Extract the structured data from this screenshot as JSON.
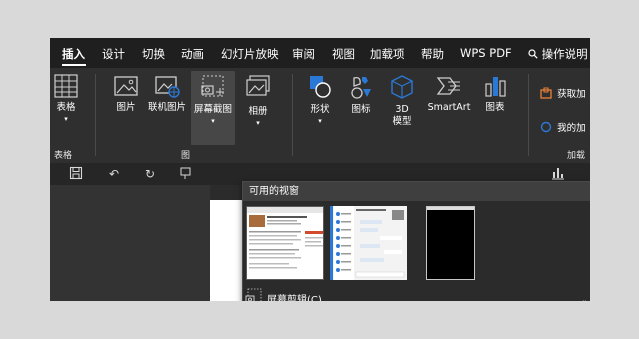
{
  "tabs": [
    {
      "label": "插入",
      "active": true
    },
    {
      "label": "设计"
    },
    {
      "label": "切换"
    },
    {
      "label": "动画"
    },
    {
      "label": "幻灯片放映"
    },
    {
      "label": "审阅"
    },
    {
      "label": "视图"
    },
    {
      "label": "加载项"
    },
    {
      "label": "帮助"
    },
    {
      "label": "WPS PDF"
    },
    {
      "label": "操作说明"
    }
  ],
  "ribbon": {
    "table": {
      "label": "表格",
      "group": "表格"
    },
    "image": {
      "label": "图片"
    },
    "online_image": {
      "label": "联机图片"
    },
    "screenshot": {
      "label": "屏幕截图"
    },
    "album": {
      "label": "相册"
    },
    "image_group": "图",
    "shapes": {
      "label": "形状"
    },
    "icons": {
      "label": "图标"
    },
    "model3d": {
      "label": "3D\n模型"
    },
    "smartart": {
      "label": "SmartArt"
    },
    "chart": {
      "label": "图表"
    },
    "get_addins": {
      "label": "获取加"
    },
    "my_addins": {
      "label": "我的加"
    },
    "addins_group": "加载"
  },
  "dropdown": {
    "header": "可用的视窗",
    "footer": "屏幕剪辑(C)",
    "thumbnails": [
      {
        "name": "window-thumbnail-document"
      },
      {
        "name": "window-thumbnail-chat"
      },
      {
        "name": "window-thumbnail-black"
      }
    ]
  },
  "colors": {
    "accent_blue": "#2b79d6",
    "addin_orange": "#e8823a",
    "tab_bar": "#1f1f1f",
    "ribbon": "#2f2f2f"
  }
}
